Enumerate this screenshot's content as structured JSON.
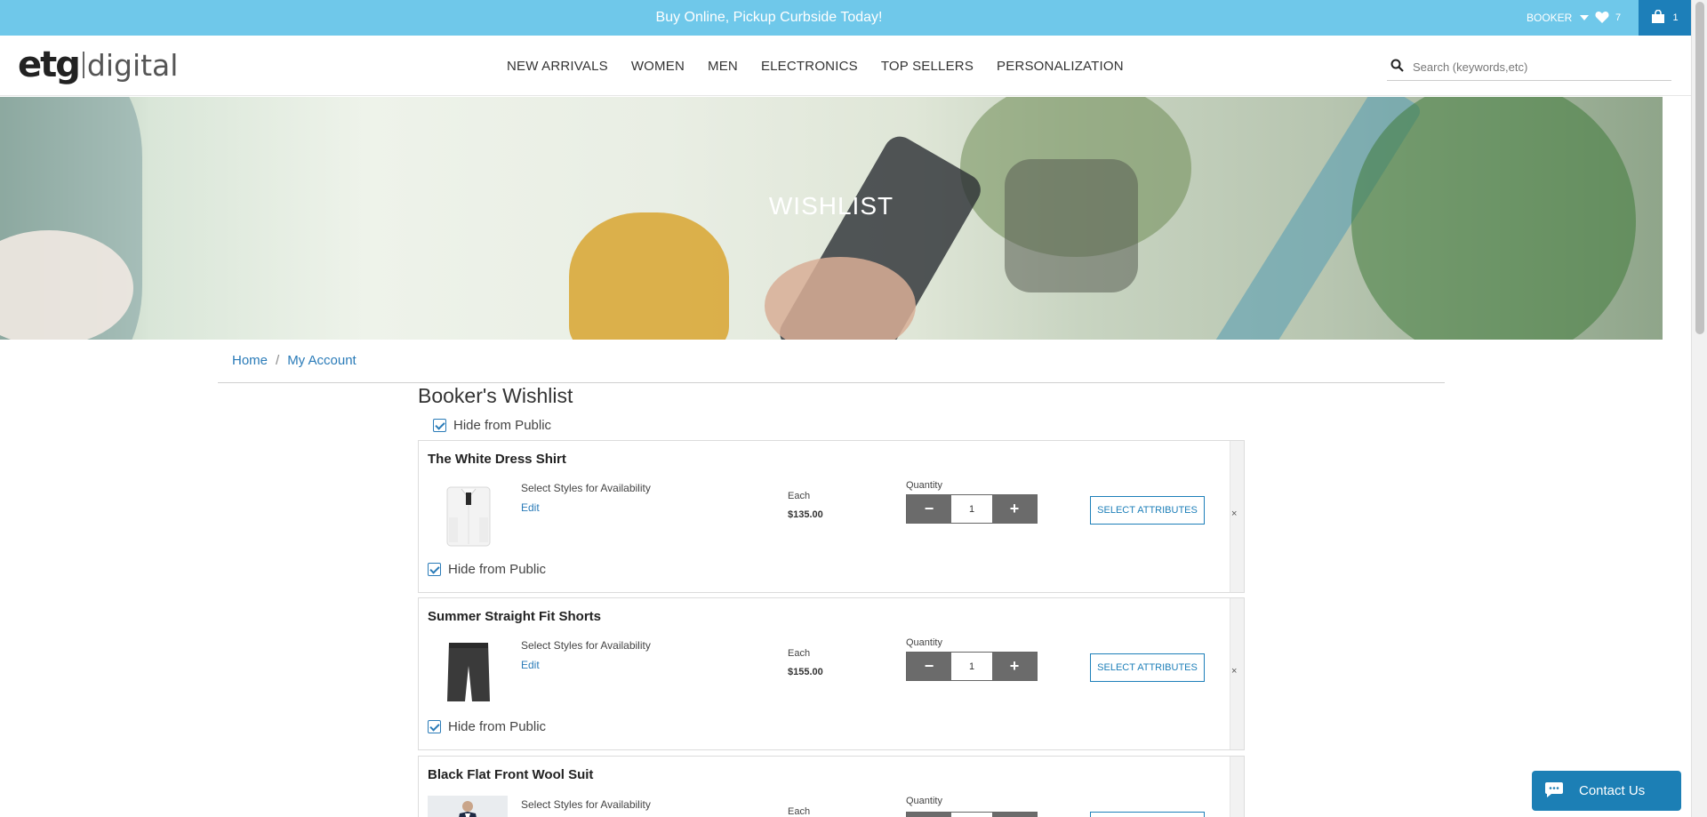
{
  "announcement": {
    "message": "Buy Online, Pickup Curbside Today!"
  },
  "account": {
    "user_label": "BOOKER",
    "wishlist_count": "7",
    "cart_count": "1"
  },
  "brand": {
    "logo_main": "etg",
    "logo_sub": "digital"
  },
  "nav": {
    "items": [
      "NEW ARRIVALS",
      "WOMEN",
      "MEN",
      "ELECTRONICS",
      "TOP SELLERS",
      "PERSONALIZATION"
    ]
  },
  "search": {
    "placeholder": "Search (keywords,etc)"
  },
  "hero": {
    "title": "WISHLIST"
  },
  "breadcrumb": {
    "home": "Home",
    "separator": "/",
    "current": "My Account"
  },
  "wishlist": {
    "title": "Booker's Wishlist",
    "hide_public_label": "Hide from Public",
    "items": [
      {
        "name": "The White Dress Shirt",
        "availability": "Select Styles for Availability",
        "edit": "Edit",
        "each_label": "Each",
        "price": "$135.00",
        "quantity_label": "Quantity",
        "quantity": "1",
        "select_label": "SELECT ATTRIBUTES",
        "remove": "×",
        "hide_public_label": "Hide from Public"
      },
      {
        "name": "Summer Straight Fit Shorts",
        "availability": "Select Styles for Availability",
        "edit": "Edit",
        "each_label": "Each",
        "price": "$155.00",
        "quantity_label": "Quantity",
        "quantity": "1",
        "select_label": "SELECT ATTRIBUTES",
        "remove": "×",
        "hide_public_label": "Hide from Public"
      },
      {
        "name": "Black Flat Front Wool Suit",
        "availability": "Select Styles for Availability",
        "each_label": "Each",
        "quantity_label": "Quantity"
      }
    ]
  },
  "chat": {
    "label": "Contact Us"
  },
  "colors": {
    "accent": "#6fc8ea",
    "primary": "#1d7fb9",
    "link": "#2a7bb8",
    "qty_button": "#6b6b6b"
  }
}
